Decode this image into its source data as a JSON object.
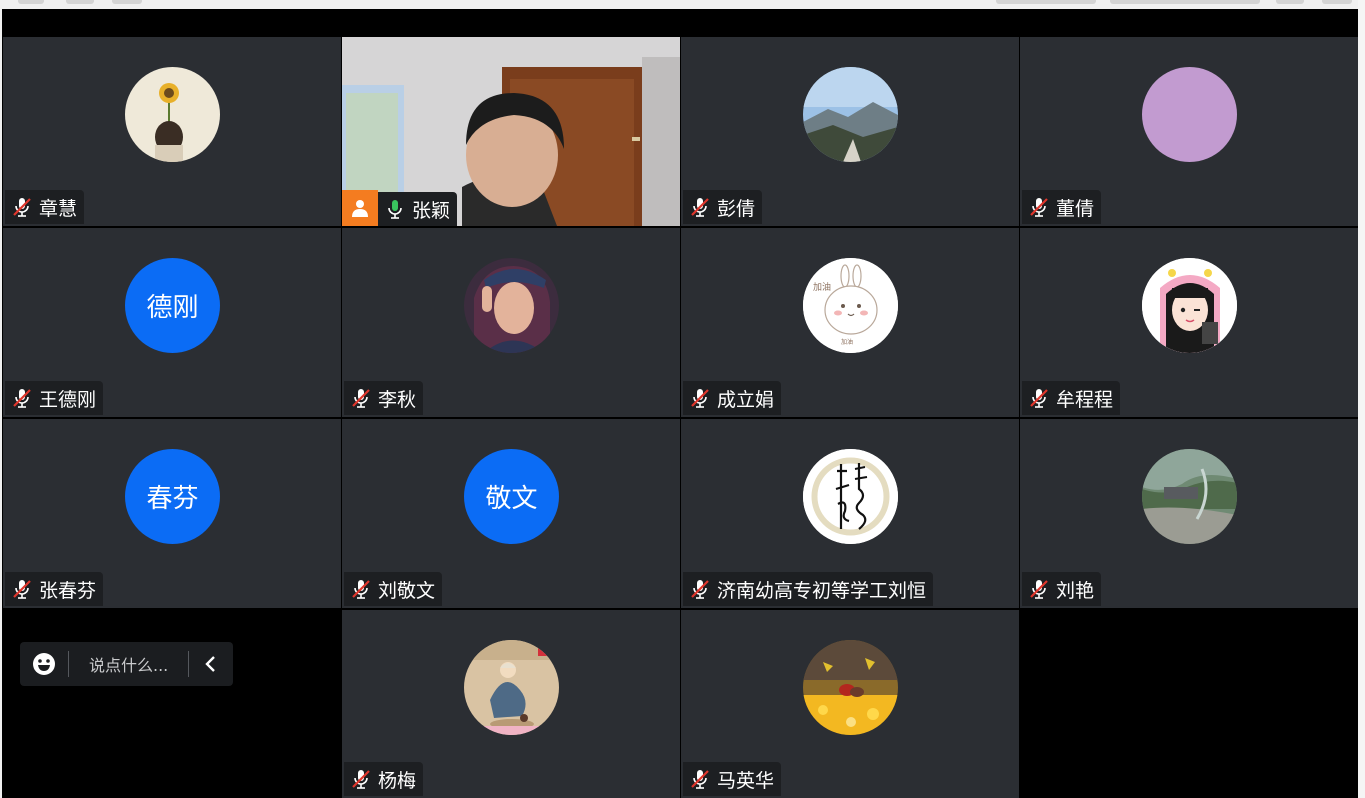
{
  "chat": {
    "placeholder": "说点什么..."
  },
  "participants": [
    {
      "name": "章慧",
      "mic": "muted",
      "avatar": "sunflower-photo"
    },
    {
      "name": "张颖",
      "mic": "active",
      "avatar": "live-video",
      "is_host": true
    },
    {
      "name": "彭倩",
      "mic": "muted",
      "avatar": "mountain-photo"
    },
    {
      "name": "董倩",
      "mic": "muted",
      "avatar": "purple-circle"
    },
    {
      "name": "王德刚",
      "mic": "muted",
      "avatar_text": "德刚"
    },
    {
      "name": "李秋",
      "mic": "muted",
      "avatar": "selfie-photo"
    },
    {
      "name": "成立娟",
      "mic": "muted",
      "avatar": "bunny-cartoon",
      "avatar_text": "加油"
    },
    {
      "name": "牟程程",
      "mic": "muted",
      "avatar": "girl-cartoon"
    },
    {
      "name": "张春芬",
      "mic": "muted",
      "avatar_text": "春芬"
    },
    {
      "name": "刘敬文",
      "mic": "muted",
      "avatar_text": "敬文"
    },
    {
      "name": "济南幼高专初等学工刘恒",
      "mic": "muted",
      "avatar": "calligraphy-seal"
    },
    {
      "name": "刘艳",
      "mic": "muted",
      "avatar": "valley-photo"
    },
    {
      "name": "杨梅",
      "mic": "muted",
      "avatar": "beach-child-photo"
    },
    {
      "name": "马英华",
      "mic": "muted",
      "avatar": "ginkgo-photo"
    }
  ],
  "colors": {
    "tile_bg": "#2b2e33",
    "text_avatar_bg": "#0b6cf5",
    "host_badge": "#f47c20",
    "active_border": "#39c35e",
    "muted_slash": "#e0362c"
  }
}
